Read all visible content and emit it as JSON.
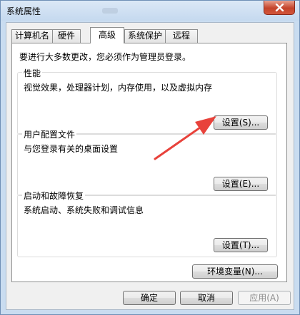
{
  "window": {
    "title": "系统属性"
  },
  "tabs": [
    {
      "label": "计算机名",
      "active": false
    },
    {
      "label": "硬件",
      "active": false
    },
    {
      "label": "高级",
      "active": true
    },
    {
      "label": "系统保护",
      "active": false
    },
    {
      "label": "远程",
      "active": false
    }
  ],
  "advanced": {
    "admin_note": "要进行大多数更改，您必须作为管理员登录。",
    "performance": {
      "title": "性能",
      "description": "视觉效果，处理器计划，内存使用，以及虚拟内存",
      "button": "设置(S)..."
    },
    "user_profiles": {
      "title": "用户配置文件",
      "description": "与您登录有关的桌面设置",
      "button": "设置(E)..."
    },
    "startup_recovery": {
      "title": "启动和故障恢复",
      "description": "系统启动、系统失败和调试信息",
      "button": "设置(T)..."
    },
    "env_button": "环境变量(N)..."
  },
  "footer": {
    "ok": "确定",
    "cancel": "取消",
    "apply": "应用(A)"
  },
  "colors": {
    "annotation_arrow": "#e8423b",
    "close_button": "#c4432a",
    "frame": "#c9dcf0"
  },
  "icons": {
    "close": "close-icon",
    "annotation": "red-arrow-annotation"
  }
}
